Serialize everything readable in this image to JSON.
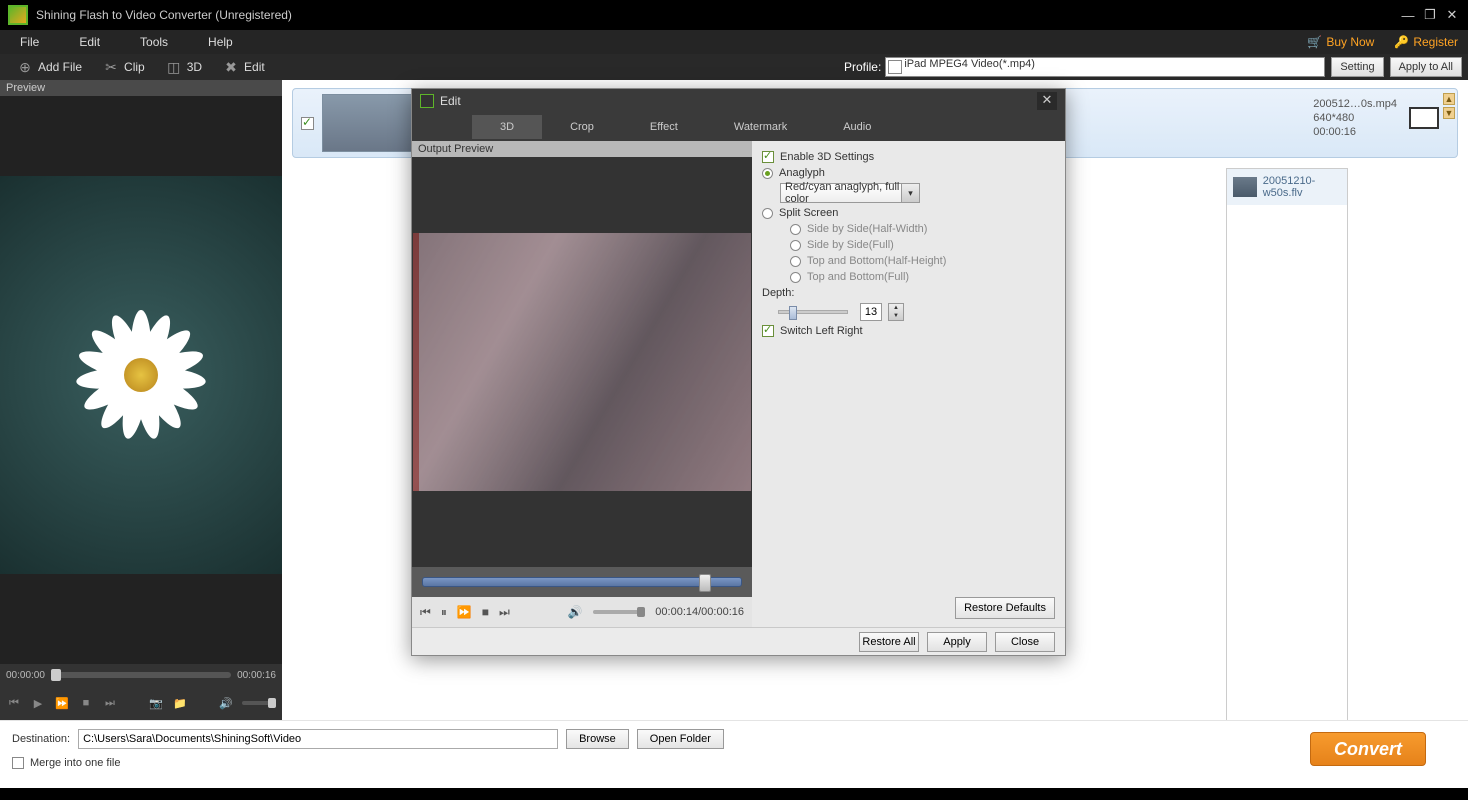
{
  "title": "Shining Flash to Video Converter (Unregistered)",
  "menubar": {
    "file": "File",
    "edit": "Edit",
    "tools": "Tools",
    "help": "Help",
    "buy": "Buy Now",
    "register": "Register"
  },
  "toolbar": {
    "addfile": "Add File",
    "clip": "Clip",
    "threeD": "3D",
    "edit": "Edit",
    "profile_label": "Profile:",
    "profile_value": "iPad MPEG4 Video(*.mp4)",
    "setting": "Setting",
    "apply_all": "Apply to All"
  },
  "preview": {
    "header": "Preview",
    "time_start": "00:00:00",
    "time_end": "00:00:16"
  },
  "fileRow": {
    "filename": "200512…0s.mp4",
    "resolution": "640*480",
    "duration": "00:00:16"
  },
  "editDialog": {
    "title": "Edit",
    "tabs": {
      "threeD": "3D",
      "crop": "Crop",
      "effect": "Effect",
      "watermark": "Watermark",
      "audio": "Audio"
    },
    "output_preview": "Output Preview",
    "opts": {
      "enable3d": "Enable 3D Settings",
      "anaglyph": "Anaglyph",
      "anaglyph_mode": "Red/cyan anaglyph, full color",
      "split": "Split Screen",
      "sbs_half": "Side by Side(Half-Width)",
      "sbs_full": "Side by Side(Full)",
      "tb_half": "Top and Bottom(Half-Height)",
      "tb_full": "Top and Bottom(Full)",
      "depth": "Depth:",
      "depth_value": "13",
      "switch_lr": "Switch Left Right",
      "restore_defaults": "Restore Defaults"
    },
    "playback_time": "00:00:14/00:00:16",
    "footer": {
      "restore_all": "Restore All",
      "apply": "Apply",
      "close": "Close"
    }
  },
  "sideList": {
    "item1": "20051210-w50s.flv"
  },
  "bottom": {
    "dest_label": "Destination:",
    "dest_path": "C:\\Users\\Sara\\Documents\\ShiningSoft\\Video",
    "browse": "Browse",
    "open_folder": "Open Folder",
    "merge": "Merge into one file",
    "convert": "Convert"
  }
}
